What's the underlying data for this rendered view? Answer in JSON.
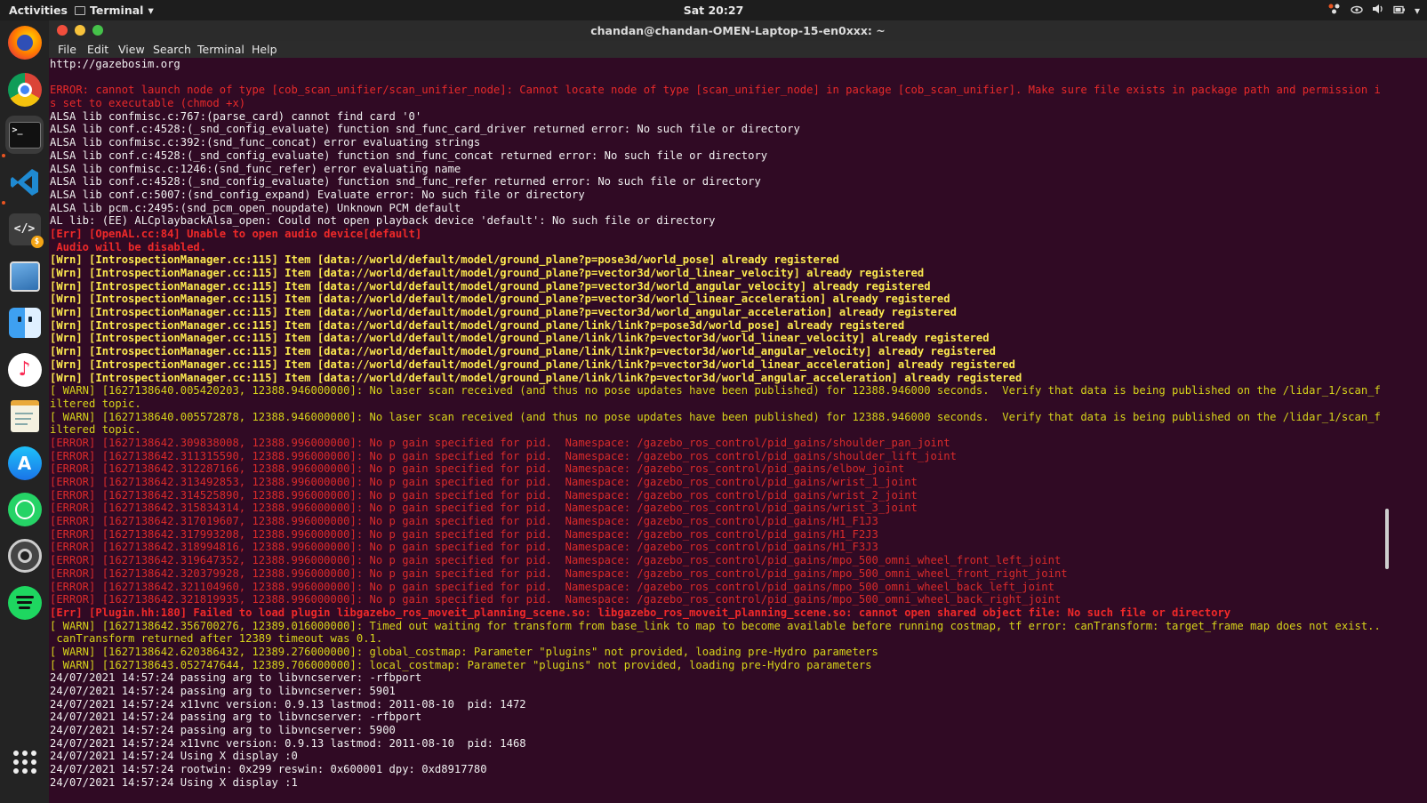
{
  "topbar": {
    "activities": "Activities",
    "app_name": "Terminal",
    "app_menu_arrow": "▾",
    "clock": "Sat 20:27",
    "tray_icons": [
      "network-icon",
      "eye-icon",
      "volume-icon",
      "battery-icon",
      "chevron-down-icon"
    ]
  },
  "dock": {
    "apps": [
      "firefox-icon",
      "chrome-icon",
      "terminal-icon",
      "vscode-icon",
      "code-editor-icon",
      "image-viewer-icon",
      "files-icon",
      "music-icon",
      "text-editor-icon",
      "app-store-icon",
      "whatsapp-icon",
      "settings-icon",
      "spotify-icon",
      "app-grid-icon"
    ]
  },
  "window": {
    "title": "chandan@chandan-OMEN-Laptop-15-en0xxx: ~",
    "menu": [
      "File",
      "Edit",
      "View",
      "Search",
      "Terminal",
      "Help"
    ]
  },
  "terminal": {
    "lines": [
      {
        "t": "http://gazebosim.org",
        "c": "normal"
      },
      {
        "t": "",
        "c": "normal"
      },
      {
        "t": "ERROR: cannot launch node of type [cob_scan_unifier/scan_unifier_node]: Cannot locate node of type [scan_unifier_node] in package [cob_scan_unifier]. Make sure file exists in package path and permission i",
        "c": "err"
      },
      {
        "t": "s set to executable (chmod +x)",
        "c": "err"
      },
      {
        "t": "ALSA lib confmisc.c:767:(parse_card) cannot find card '0'",
        "c": "normal"
      },
      {
        "t": "ALSA lib conf.c:4528:(_snd_config_evaluate) function snd_func_card_driver returned error: No such file or directory",
        "c": "normal"
      },
      {
        "t": "ALSA lib confmisc.c:392:(snd_func_concat) error evaluating strings",
        "c": "normal"
      },
      {
        "t": "ALSA lib conf.c:4528:(_snd_config_evaluate) function snd_func_concat returned error: No such file or directory",
        "c": "normal"
      },
      {
        "t": "ALSA lib confmisc.c:1246:(snd_func_refer) error evaluating name",
        "c": "normal"
      },
      {
        "t": "ALSA lib conf.c:4528:(_snd_config_evaluate) function snd_func_refer returned error: No such file or directory",
        "c": "normal"
      },
      {
        "t": "ALSA lib conf.c:5007:(snd_config_expand) Evaluate error: No such file or directory",
        "c": "normal"
      },
      {
        "t": "ALSA lib pcm.c:2495:(snd_pcm_open_noupdate) Unknown PCM default",
        "c": "normal"
      },
      {
        "t": "AL lib: (EE) ALCplaybackAlsa_open: Could not open playback device 'default': No such file or directory",
        "c": "normal"
      },
      {
        "t": "[Err] [OpenAL.cc:84] Unable to open audio device[default]",
        "c": "errb"
      },
      {
        "t": " Audio will be disabled.",
        "c": "errb"
      },
      {
        "t": "[Wrn] [IntrospectionManager.cc:115] Item [data://world/default/model/ground_plane?p=pose3d/world_pose] already registered",
        "c": "wrn"
      },
      {
        "t": "[Wrn] [IntrospectionManager.cc:115] Item [data://world/default/model/ground_plane?p=vector3d/world_linear_velocity] already registered",
        "c": "wrn"
      },
      {
        "t": "[Wrn] [IntrospectionManager.cc:115] Item [data://world/default/model/ground_plane?p=vector3d/world_angular_velocity] already registered",
        "c": "wrn"
      },
      {
        "t": "[Wrn] [IntrospectionManager.cc:115] Item [data://world/default/model/ground_plane?p=vector3d/world_linear_acceleration] already registered",
        "c": "wrn"
      },
      {
        "t": "[Wrn] [IntrospectionManager.cc:115] Item [data://world/default/model/ground_plane?p=vector3d/world_angular_acceleration] already registered",
        "c": "wrn"
      },
      {
        "t": "[Wrn] [IntrospectionManager.cc:115] Item [data://world/default/model/ground_plane/link/link?p=pose3d/world_pose] already registered",
        "c": "wrn"
      },
      {
        "t": "[Wrn] [IntrospectionManager.cc:115] Item [data://world/default/model/ground_plane/link/link?p=vector3d/world_linear_velocity] already registered",
        "c": "wrn"
      },
      {
        "t": "[Wrn] [IntrospectionManager.cc:115] Item [data://world/default/model/ground_plane/link/link?p=vector3d/world_angular_velocity] already registered",
        "c": "wrn"
      },
      {
        "t": "[Wrn] [IntrospectionManager.cc:115] Item [data://world/default/model/ground_plane/link/link?p=vector3d/world_linear_acceleration] already registered",
        "c": "wrn"
      },
      {
        "t": "[Wrn] [IntrospectionManager.cc:115] Item [data://world/default/model/ground_plane/link/link?p=vector3d/world_angular_acceleration] already registered",
        "c": "wrn"
      },
      {
        "t": "[ WARN] [1627138640.005420203, 12388.946000000]: No laser scan received (and thus no pose updates have been published) for 12388.946000 seconds.  Verify that data is being published on the /lidar_1/scan_f",
        "c": "warn"
      },
      {
        "t": "iltered topic.",
        "c": "warn"
      },
      {
        "t": "[ WARN] [1627138640.005572878, 12388.946000000]: No laser scan received (and thus no pose updates have been published) for 12388.946000 seconds.  Verify that data is being published on the /lidar_1/scan_f",
        "c": "warn"
      },
      {
        "t": "iltered topic.",
        "c": "warn"
      },
      {
        "t": "[ERROR] [1627138642.309838008, 12388.996000000]: No p gain specified for pid.  Namespace: /gazebo_ros_control/pid_gains/shoulder_pan_joint",
        "c": "rerr"
      },
      {
        "t": "[ERROR] [1627138642.311315590, 12388.996000000]: No p gain specified for pid.  Namespace: /gazebo_ros_control/pid_gains/shoulder_lift_joint",
        "c": "rerr"
      },
      {
        "t": "[ERROR] [1627138642.312287166, 12388.996000000]: No p gain specified for pid.  Namespace: /gazebo_ros_control/pid_gains/elbow_joint",
        "c": "rerr"
      },
      {
        "t": "[ERROR] [1627138642.313492853, 12388.996000000]: No p gain specified for pid.  Namespace: /gazebo_ros_control/pid_gains/wrist_1_joint",
        "c": "rerr"
      },
      {
        "t": "[ERROR] [1627138642.314525890, 12388.996000000]: No p gain specified for pid.  Namespace: /gazebo_ros_control/pid_gains/wrist_2_joint",
        "c": "rerr"
      },
      {
        "t": "[ERROR] [1627138642.315834314, 12388.996000000]: No p gain specified for pid.  Namespace: /gazebo_ros_control/pid_gains/wrist_3_joint",
        "c": "rerr"
      },
      {
        "t": "[ERROR] [1627138642.317019607, 12388.996000000]: No p gain specified for pid.  Namespace: /gazebo_ros_control/pid_gains/H1_F1J3",
        "c": "rerr"
      },
      {
        "t": "[ERROR] [1627138642.317993208, 12388.996000000]: No p gain specified for pid.  Namespace: /gazebo_ros_control/pid_gains/H1_F2J3",
        "c": "rerr"
      },
      {
        "t": "[ERROR] [1627138642.318994816, 12388.996000000]: No p gain specified for pid.  Namespace: /gazebo_ros_control/pid_gains/H1_F3J3",
        "c": "rerr"
      },
      {
        "t": "[ERROR] [1627138642.319647352, 12388.996000000]: No p gain specified for pid.  Namespace: /gazebo_ros_control/pid_gains/mpo_500_omni_wheel_front_left_joint",
        "c": "rerr"
      },
      {
        "t": "[ERROR] [1627138642.320379928, 12388.996000000]: No p gain specified for pid.  Namespace: /gazebo_ros_control/pid_gains/mpo_500_omni_wheel_front_right_joint",
        "c": "rerr"
      },
      {
        "t": "[ERROR] [1627138642.321104960, 12388.996000000]: No p gain specified for pid.  Namespace: /gazebo_ros_control/pid_gains/mpo_500_omni_wheel_back_left_joint",
        "c": "rerr"
      },
      {
        "t": "[ERROR] [1627138642.321819935, 12388.996000000]: No p gain specified for pid.  Namespace: /gazebo_ros_control/pid_gains/mpo_500_omni_wheel_back_right_joint",
        "c": "rerr"
      },
      {
        "t": "[Err] [Plugin.hh:180] Failed to load plugin libgazebo_ros_moveit_planning_scene.so: libgazebo_ros_moveit_planning_scene.so: cannot open shared object file: No such file or directory",
        "c": "errb"
      },
      {
        "t": "[ WARN] [1627138642.356700276, 12389.016000000]: Timed out waiting for transform from base_link to map to become available before running costmap, tf error: canTransform: target_frame map does not exist..",
        "c": "warn"
      },
      {
        "t": " canTransform returned after 12389 timeout was 0.1.",
        "c": "warn"
      },
      {
        "t": "[ WARN] [1627138642.620386432, 12389.276000000]: global_costmap: Parameter \"plugins\" not provided, loading pre-Hydro parameters",
        "c": "warn"
      },
      {
        "t": "[ WARN] [1627138643.052747644, 12389.706000000]: local_costmap: Parameter \"plugins\" not provided, loading pre-Hydro parameters",
        "c": "warn"
      },
      {
        "t": "24/07/2021 14:57:24 passing arg to libvncserver: -rfbport",
        "c": "normal"
      },
      {
        "t": "24/07/2021 14:57:24 passing arg to libvncserver: 5901",
        "c": "normal"
      },
      {
        "t": "24/07/2021 14:57:24 x11vnc version: 0.9.13 lastmod: 2011-08-10  pid: 1472",
        "c": "normal"
      },
      {
        "t": "24/07/2021 14:57:24 passing arg to libvncserver: -rfbport",
        "c": "normal"
      },
      {
        "t": "24/07/2021 14:57:24 passing arg to libvncserver: 5900",
        "c": "normal"
      },
      {
        "t": "24/07/2021 14:57:24 x11vnc version: 0.9.13 lastmod: 2011-08-10  pid: 1468",
        "c": "normal"
      },
      {
        "t": "24/07/2021 14:57:24 Using X display :0",
        "c": "normal"
      },
      {
        "t": "24/07/2021 14:57:24 rootwin: 0x299 reswin: 0x600001 dpy: 0xd8917780",
        "c": "normal"
      },
      {
        "t": "24/07/2021 14:57:24 Using X display :1",
        "c": "normal"
      }
    ]
  }
}
